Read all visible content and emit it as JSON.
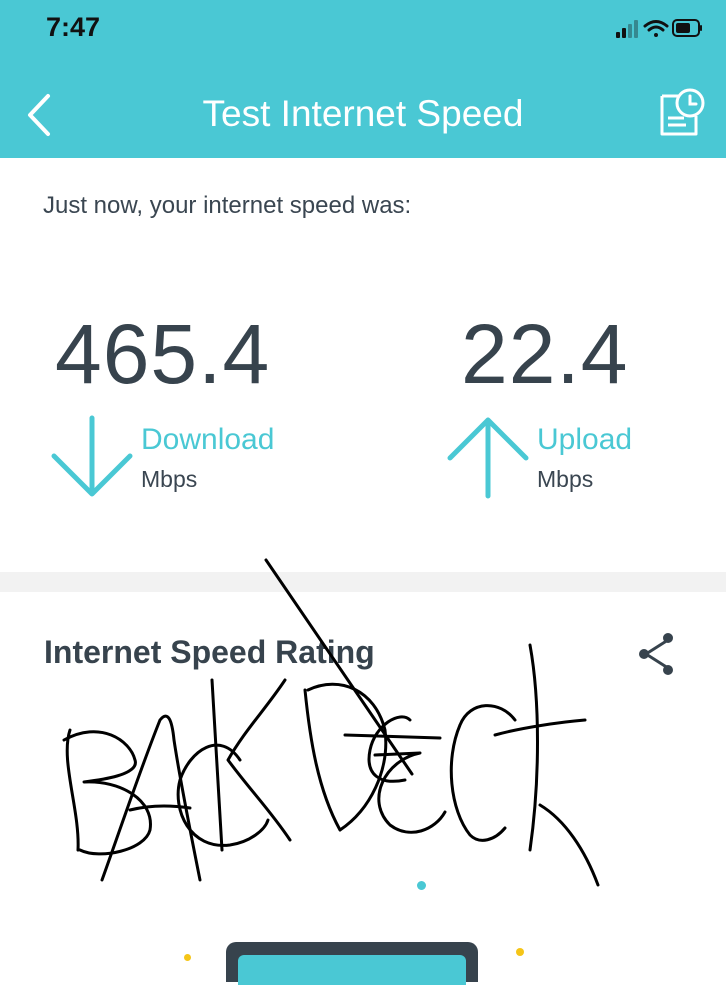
{
  "status_bar": {
    "time": "7:47"
  },
  "nav": {
    "title": "Test Internet Speed"
  },
  "summary": {
    "text": "Just now, your internet speed was:"
  },
  "download": {
    "value": "465.4",
    "label": "Download",
    "unit": "Mbps"
  },
  "upload": {
    "value": "22.4",
    "label": "Upload",
    "unit": "Mbps"
  },
  "rating": {
    "title": "Internet Speed Rating"
  },
  "colors": {
    "accent": "#4ac8d4",
    "text": "#37434d",
    "dot_yellow": "#f5c518"
  },
  "icons": {
    "back": "chevron-left-icon",
    "history": "history-report-icon",
    "download": "arrow-down-icon",
    "upload": "arrow-up-icon",
    "share": "share-icon"
  }
}
